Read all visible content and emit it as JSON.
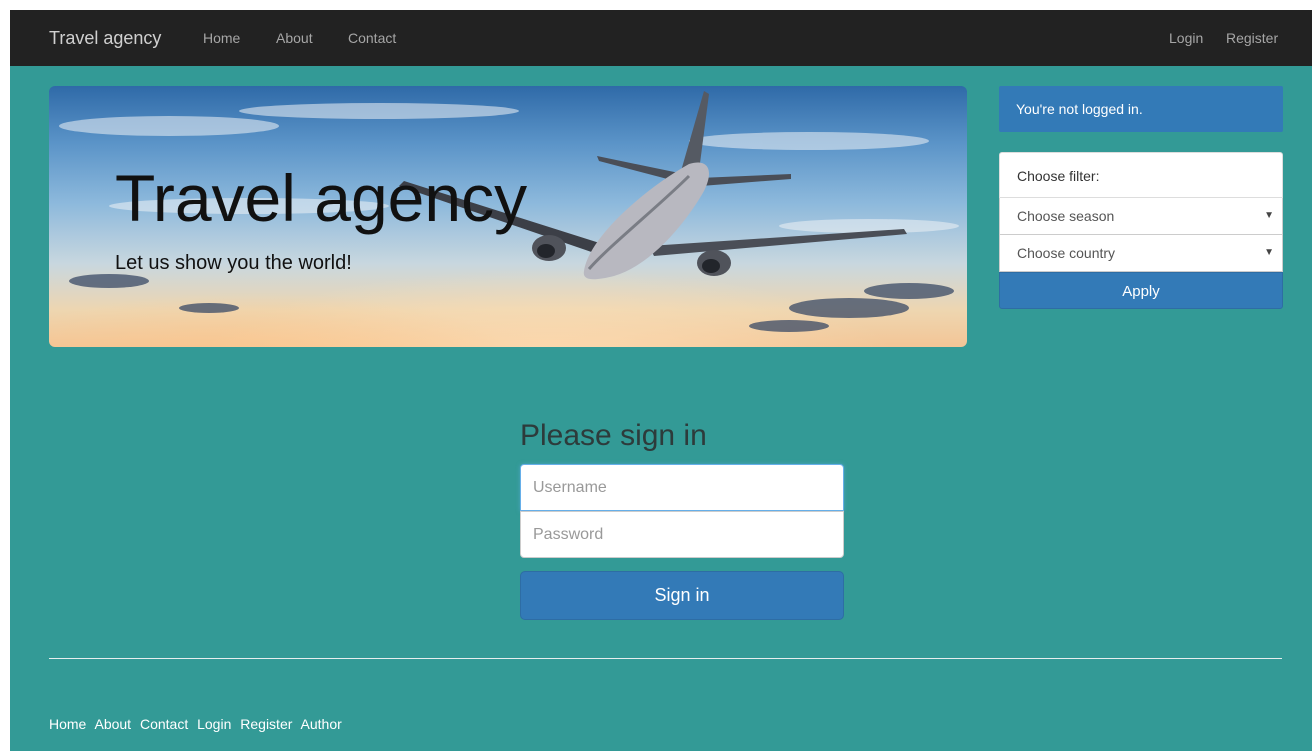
{
  "navbar": {
    "brand": "Travel agency",
    "links": [
      {
        "label": "Home"
      },
      {
        "label": "About"
      },
      {
        "label": "Contact"
      }
    ],
    "right_links": [
      {
        "label": "Login"
      },
      {
        "label": "Register"
      }
    ]
  },
  "hero": {
    "title": "Travel agency",
    "subtitle": "Let us show you the world!"
  },
  "sidebar": {
    "status": "You're not logged in.",
    "filter_label": "Choose filter:",
    "season_select": "Choose season",
    "country_select": "Choose country",
    "apply_label": "Apply"
  },
  "signin": {
    "title": "Please sign in",
    "username_placeholder": "Username",
    "password_placeholder": "Password",
    "button_label": "Sign in"
  },
  "footer": {
    "links": [
      {
        "label": "Home"
      },
      {
        "label": "About"
      },
      {
        "label": "Contact"
      },
      {
        "label": "Login"
      },
      {
        "label": "Register"
      },
      {
        "label": "Author"
      }
    ]
  },
  "colors": {
    "background": "#339a96",
    "navbar": "#222222",
    "primary": "#337ab7"
  }
}
